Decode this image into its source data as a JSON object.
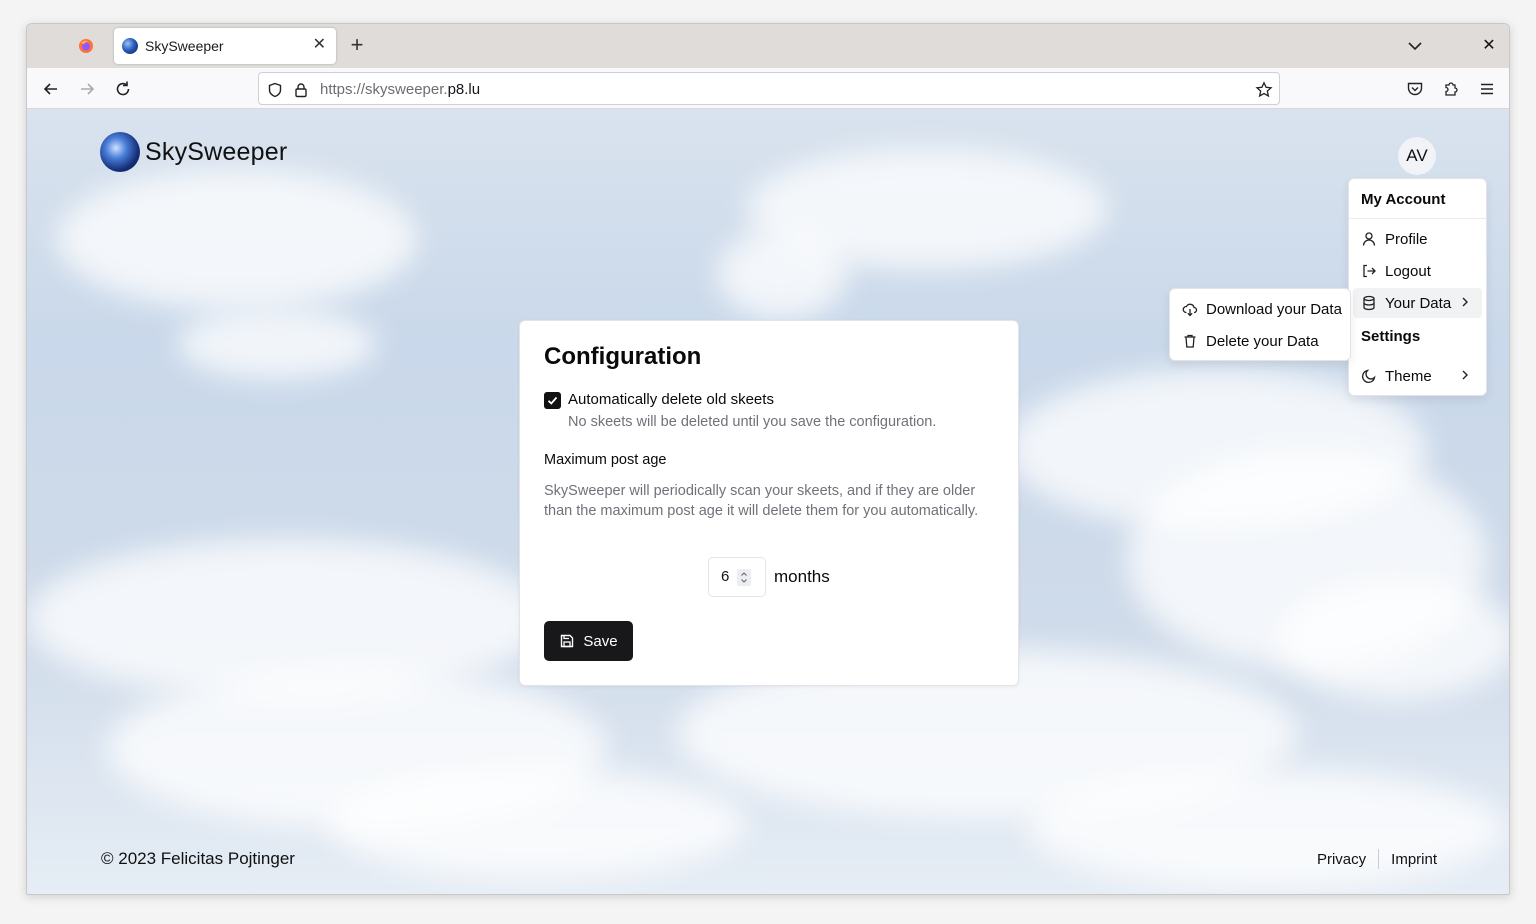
{
  "browser": {
    "tab_title": "SkySweeper",
    "url_prefix": "https://skysweeper.",
    "url_host": "p8.lu"
  },
  "header": {
    "app_name": "SkySweeper",
    "avatar_initials": "AV"
  },
  "config": {
    "title": "Configuration",
    "auto_delete_label": "Automatically delete old skeets",
    "auto_delete_checked": true,
    "auto_delete_desc": "No skeets will be deleted until you save the configuration.",
    "max_age_label": "Maximum post age",
    "max_age_desc": "SkySweeper will periodically scan your skeets, and if they are older than the maximum post age it will delete them for you automatically.",
    "max_age_value": "6",
    "max_age_unit": "months",
    "save_label": "Save"
  },
  "account_menu": {
    "heading": "My Account",
    "items": [
      {
        "label": "Profile",
        "icon": "user-icon"
      },
      {
        "label": "Logout",
        "icon": "logout-icon"
      },
      {
        "label": "Your Data",
        "icon": "database-icon"
      }
    ],
    "settings_heading": "Settings",
    "settings_items": [
      {
        "label": "Theme",
        "icon": "moon-icon"
      }
    ]
  },
  "data_submenu": {
    "items": [
      {
        "label": "Download your Data",
        "icon": "cloud-download-icon"
      },
      {
        "label": "Delete your Data",
        "icon": "trash-icon"
      }
    ]
  },
  "footer": {
    "copyright": "© 2023 Felicitas Pojtinger",
    "links": [
      "Privacy",
      "Imprint"
    ]
  }
}
